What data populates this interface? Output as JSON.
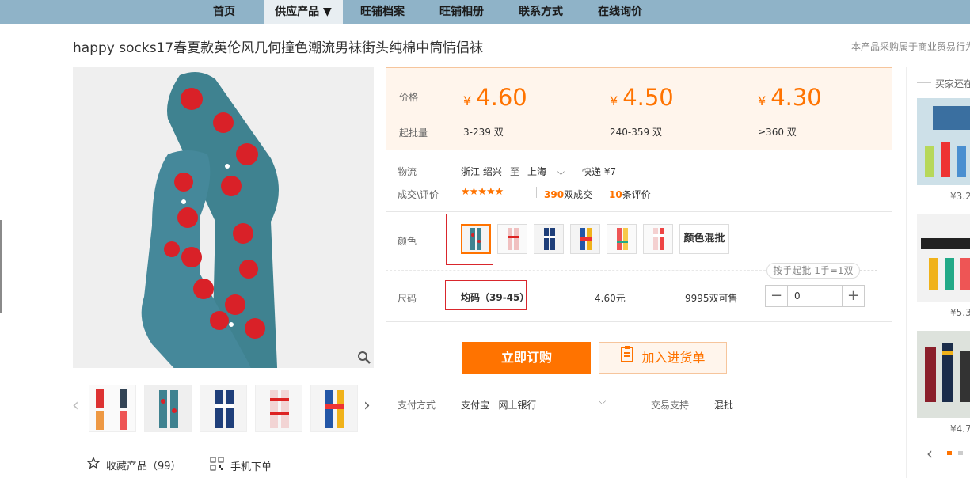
{
  "nav": {
    "items": [
      {
        "label": "首页"
      },
      {
        "label": "供应产品 ▼"
      },
      {
        "label": "旺铺档案"
      },
      {
        "label": "旺铺相册"
      },
      {
        "label": "联系方式"
      },
      {
        "label": "在线询价"
      }
    ]
  },
  "product": {
    "title": "happy socks17春夏款英伦风几何撞色潮流男袜街头纯棉中筒情侣袜",
    "notice": "本产品采购属于商业贸易行为"
  },
  "pricing": {
    "price_label": "价格",
    "moq_label": "起批量",
    "currency": "¥",
    "tiers": [
      {
        "price": "4.60",
        "range": "3-239",
        "unit": "双"
      },
      {
        "price": "4.50",
        "range": "240-359",
        "unit": "双"
      },
      {
        "price": "4.30",
        "range": "≥360",
        "unit": "双"
      }
    ]
  },
  "logistics": {
    "label": "物流",
    "from": "浙江 绍兴",
    "to_word": "至",
    "to": "上海",
    "shipping": "快递 ¥7"
  },
  "reviews": {
    "label": "成交\\评价",
    "stars": "★★★★★",
    "deals_count": "390",
    "deals_text": "双成交",
    "review_count": "10",
    "review_text": "条评价"
  },
  "color": {
    "label": "颜色",
    "mix_label": "颜色混批"
  },
  "size": {
    "label": "尺码",
    "hint": "按手起批 1手=1双",
    "value": "均码（39-45）",
    "price": "4.60元",
    "stock": "9995双可售",
    "quantity": "0"
  },
  "actions": {
    "buy": "立即订购",
    "cart": "加入进货单",
    "favorite": "收藏产品（99）",
    "mobile": "手机下单"
  },
  "payment": {
    "label": "支付方式",
    "methods": "支付宝   网上银行",
    "support_label": "交易支持",
    "support_value": "混批"
  },
  "sidebar": {
    "title": "买家还在看",
    "items": [
      {
        "price": "¥3.2"
      },
      {
        "price": "¥5.3"
      },
      {
        "price": "¥4.7"
      }
    ]
  },
  "colors": {
    "accent": "#ff7300",
    "nav_bg": "#8fb3c8",
    "price_bg": "#fff5ec",
    "sock_teal": "#3f8290",
    "paddle_red": "#d92128"
  }
}
